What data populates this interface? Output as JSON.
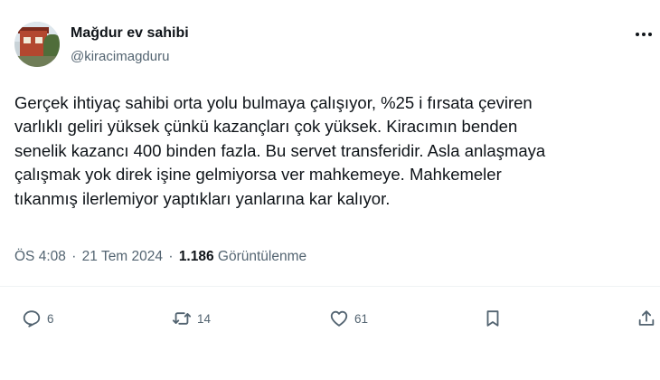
{
  "author": {
    "display_name": "Mağdur ev sahibi",
    "handle": "@kiracimagduru",
    "avatar_icon": "house-avatar"
  },
  "tweet": {
    "text": "Gerçek ihtiyaç sahibi orta yolu bulmaya çalışıyor, %25 i fırsata çeviren\nvarlıklı geliri yüksek çünkü kazançları çok yüksek. Kiracımın benden\nsenelik kazancı 400 binden fazla. Bu servet transferidir. Asla anlaşmaya\nçalışmak yok direk işine gelmiyorsa ver mahkemeye. Mahkemeler\ntıkanmış ilerlemiyor yaptıkları yanlarına kar kalıyor."
  },
  "meta": {
    "time": "ÖS 4:08",
    "separator": "·",
    "date": "21 Tem 2024",
    "views_count": "1.186",
    "views_label": "Görüntülenme"
  },
  "actions": {
    "reply_count": "6",
    "retweet_count": "14",
    "like_count": "61"
  },
  "colors": {
    "text_primary": "#0f1419",
    "text_secondary": "#536471",
    "divider": "#eff3f4"
  }
}
